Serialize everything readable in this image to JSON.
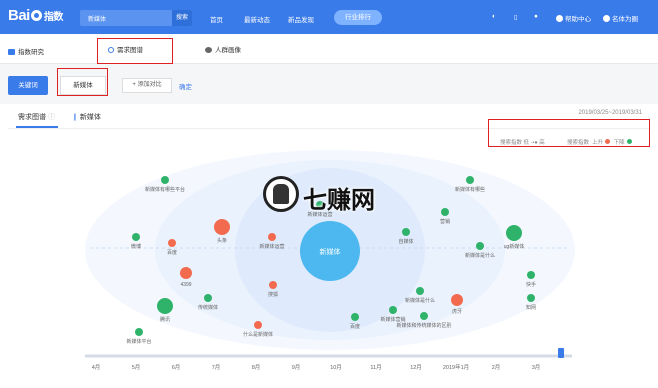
{
  "header": {
    "logo_bai": "Bai",
    "logo_zh": "指数",
    "search_value": "新媒体",
    "search_button": "搜索",
    "nav": [
      "首页",
      "最新动态",
      "新品发现"
    ],
    "rank_pill": "行业排行",
    "help": "帮助中心",
    "user": "名体为圈"
  },
  "subnav": {
    "index_research": "指数研究",
    "demand_map": "需求图谱",
    "crowd_portrait": "人群画像"
  },
  "keywords": {
    "keyword_button": "关键词",
    "keyword_tag": "新媒体",
    "add_compare": "+ 添加对比",
    "confirm": "确定"
  },
  "panel": {
    "tab_demand": "需求图谱",
    "tab_keyword": "新媒体",
    "date_range": "2019/03/25~2019/03/31",
    "legend_search_index": "搜索指数",
    "legend_high": "高",
    "legend_low": "低",
    "legend_trend": "搜索指数",
    "legend_up": "上升",
    "legend_down": "下降",
    "colors": {
      "up": "#f26b4f",
      "down": "#2fb36b",
      "center": "#4db8f0",
      "accent": "#3a7bea"
    },
    "center_label": "新媒体",
    "timeline": [
      "4月",
      "5月",
      "6月",
      "7月",
      "8月",
      "9月",
      "10月",
      "11月",
      "12月",
      "2019年1月",
      "2月",
      "3月"
    ]
  },
  "bubbles": [
    {
      "label": "新媒体有哪些平台",
      "kind": "down",
      "size": 2
    },
    {
      "label": "新媒体运营",
      "kind": "down",
      "size": 2
    },
    {
      "label": "新媒体有哪些",
      "kind": "down",
      "size": 2
    },
    {
      "label": "营销",
      "kind": "down",
      "size": 2
    },
    {
      "label": "头条",
      "kind": "up",
      "size": 4
    },
    {
      "label": "新媒体运营",
      "kind": "up",
      "size": 2
    },
    {
      "label": "百度",
      "kind": "up",
      "size": 2
    },
    {
      "label": "微博",
      "kind": "down",
      "size": 2
    },
    {
      "label": "自媒体",
      "kind": "down",
      "size": 2
    },
    {
      "label": "新媒体是什么",
      "kind": "down",
      "size": 2
    },
    {
      "label": "ug新媒体",
      "kind": "down",
      "size": 4
    },
    {
      "label": "快手",
      "kind": "down",
      "size": 2
    },
    {
      "label": "4399",
      "kind": "up",
      "size": 3
    },
    {
      "label": "传统媒体",
      "kind": "down",
      "size": 2
    },
    {
      "label": "搜狐",
      "kind": "up",
      "size": 2
    },
    {
      "label": "新媒体是什么",
      "kind": "down",
      "size": 2
    },
    {
      "label": "虎牙",
      "kind": "up",
      "size": 3
    },
    {
      "label": "知网",
      "kind": "down",
      "size": 2
    },
    {
      "label": "腾讯",
      "kind": "down",
      "size": 4
    },
    {
      "label": "什么是新媒体",
      "kind": "up",
      "size": 2
    },
    {
      "label": "百度",
      "kind": "down",
      "size": 2
    },
    {
      "label": "新媒体营销",
      "kind": "down",
      "size": 2
    },
    {
      "label": "新媒体和传统媒体的区别",
      "kind": "down",
      "size": 2
    },
    {
      "label": "新媒体平台",
      "kind": "down",
      "size": 2
    }
  ],
  "watermark": "七赚网"
}
